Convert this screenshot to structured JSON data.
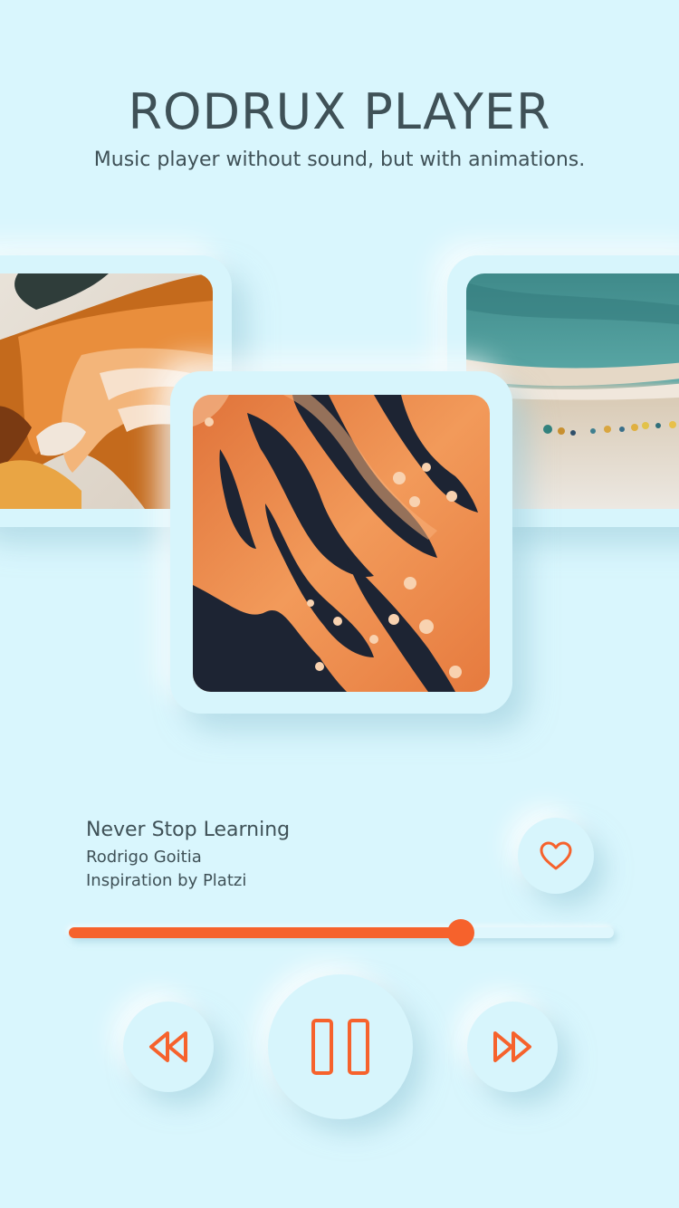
{
  "header": {
    "title": "RODRUX PLAYER",
    "subtitle": "Music player without sound, but with animations."
  },
  "carousel": {
    "items": [
      {
        "name": "album-art-left",
        "position": "previous"
      },
      {
        "name": "album-art-center",
        "position": "current"
      },
      {
        "name": "album-art-right",
        "position": "next"
      }
    ]
  },
  "track": {
    "title": "Never Stop Learning",
    "artist": "Rodrigo Goitia",
    "album": "Inspiration by Platzi"
  },
  "progress": {
    "fraction": 0.72
  },
  "controls": {
    "like_icon": "heart-icon",
    "rewind_icon": "rewind-icon",
    "pause_icon": "pause-icon",
    "forward_icon": "fast-forward-icon"
  },
  "colors": {
    "background": "#d9f6fd",
    "accent": "#f6622c",
    "text": "#3f5157"
  }
}
